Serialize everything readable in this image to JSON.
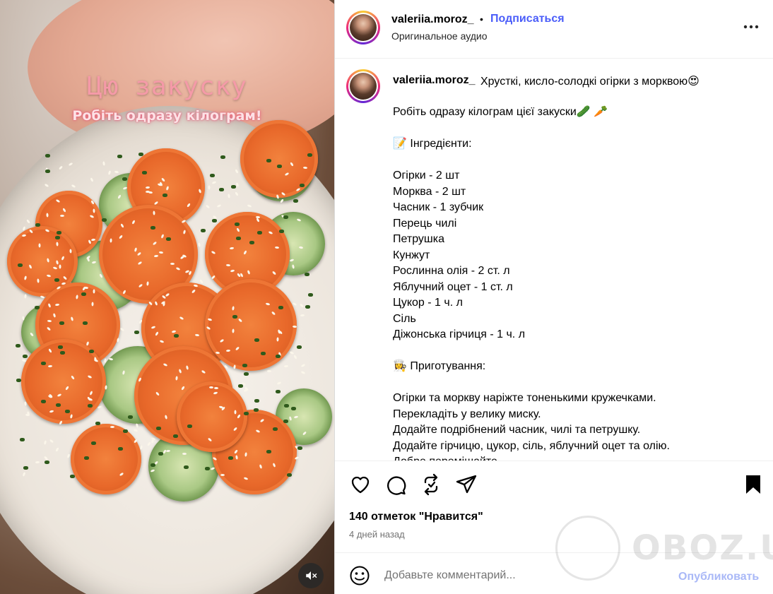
{
  "media": {
    "overlay_title": "Цю закуску",
    "overlay_subtitle": "Робіть одразу кілограм!",
    "mute_icon": "speaker-muted-icon"
  },
  "header": {
    "username": "valeriia.moroz_",
    "separator": "•",
    "follow_label": "Подписаться",
    "audio_label": "Оригинальное аудио",
    "more_icon": "more-horizontal-icon"
  },
  "caption": {
    "username": "valeriia.moroz_",
    "headline": "Хрусткі, кисло-солодкі огірки з морквою😍",
    "lines": [
      "Робіть одразу кілограм цієї закуски🥒 🥕",
      "",
      "📝 Інгредієнти:",
      "",
      "Огірки - 2 шт",
      "Морква - 2 шт",
      "Часник - 1 зубчик",
      "Перець чилі",
      "Петрушка",
      "Кунжут",
      "Рослинна олія - 2 ст. л",
      "Яблучний оцет - 1 ст. л",
      "Цукор - 1 ч. л",
      "Сіль",
      "Діжонська гірчиця - 1 ч. л",
      "",
      "👩‍🍳 Приготування:",
      "",
      "Огірки та моркву наріжте тоненькими кружечками.",
      "Перекладіть у велику миску.",
      "Додайте подрібнений часник, чилі та петрушку.",
      "Додайте гірчицю, цукор, сіль, яблучний оцет та олію.",
      "Добре перемішайте."
    ]
  },
  "actions": {
    "icons": [
      "heart-icon",
      "comment-icon",
      "repost-icon",
      "share-icon",
      "bookmark-icon"
    ],
    "likes_text": "140 отметок \"Нравится\"",
    "time_ago": "4 дней назад"
  },
  "comment": {
    "placeholder": "Добавьте комментарий...",
    "publish_label": "Опубликовать"
  },
  "watermark": {
    "text": "OBOZ.UA"
  },
  "colors": {
    "follow_blue": "#4a5df9",
    "publish_disabled": "#a9b8f7",
    "overlay_pink": "#f59aa8"
  }
}
